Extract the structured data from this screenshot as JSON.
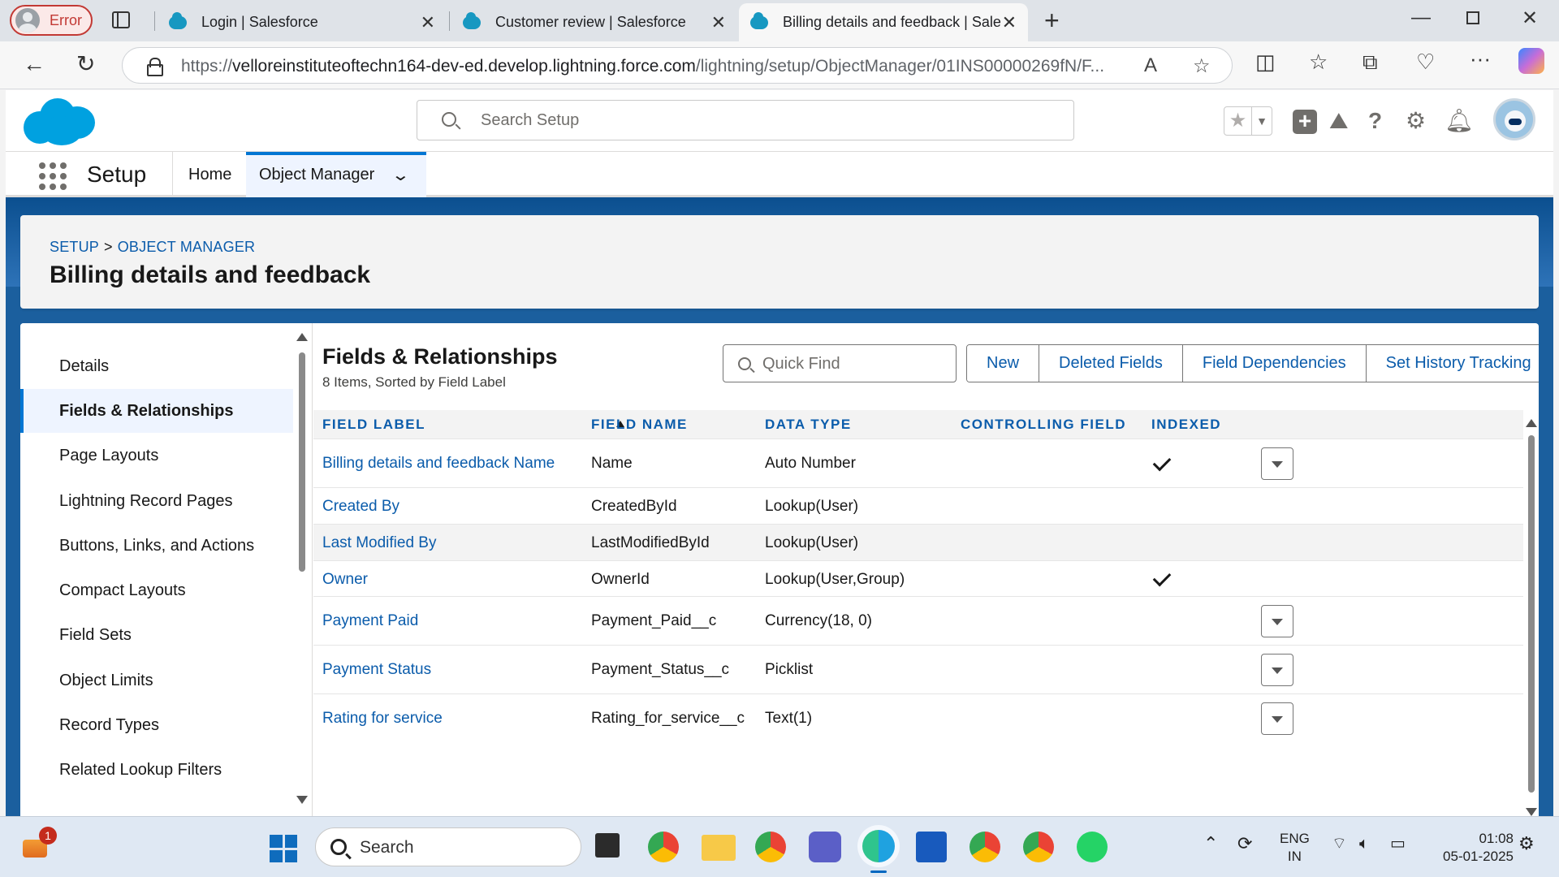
{
  "browser": {
    "profile_status": "Error",
    "tabs": [
      {
        "title": "Login | Salesforce",
        "active": false
      },
      {
        "title": "Customer review | Salesforce",
        "active": false
      },
      {
        "title": "Billing details and feedback | Sale",
        "active": true
      }
    ],
    "url_prefix": "https://",
    "url_host": "velloreinstituteoftechn164-dev-ed.develop.lightning.force.com",
    "url_path": "/lightning/setup/ObjectManager/01INS00000269fN/F..."
  },
  "sf_header": {
    "search_placeholder": "Search Setup"
  },
  "app_nav": {
    "app_name": "Setup",
    "items": [
      {
        "label": "Home"
      },
      {
        "label": "Object Manager",
        "active": true
      }
    ]
  },
  "page_header": {
    "breadcrumb_setup": "SETUP",
    "breadcrumb_sep": ">",
    "breadcrumb_object_manager": "OBJECT MANAGER",
    "title": "Billing details and feedback"
  },
  "sidebar": {
    "items": [
      {
        "label": "Details"
      },
      {
        "label": "Fields & Relationships",
        "active": true
      },
      {
        "label": "Page Layouts"
      },
      {
        "label": "Lightning Record Pages"
      },
      {
        "label": "Buttons, Links, and Actions"
      },
      {
        "label": "Compact Layouts"
      },
      {
        "label": "Field Sets"
      },
      {
        "label": "Object Limits"
      },
      {
        "label": "Record Types"
      },
      {
        "label": "Related Lookup Filters"
      }
    ]
  },
  "section": {
    "title": "Fields & Relationships",
    "subtitle": "8 Items, Sorted by Field Label",
    "quick_find_placeholder": "Quick Find",
    "buttons": [
      "New",
      "Deleted Fields",
      "Field Dependencies",
      "Set History Tracking"
    ]
  },
  "table": {
    "columns": [
      "FIELD LABEL",
      "FIELD NAME",
      "DATA TYPE",
      "CONTROLLING FIELD",
      "INDEXED"
    ],
    "rows": [
      {
        "label": "Billing details and feedback Name",
        "name": "Name",
        "type": "Auto Number",
        "indexed": true,
        "menu": true
      },
      {
        "label": "Created By",
        "name": "CreatedById",
        "type": "Lookup(User)",
        "indexed": false,
        "menu": false
      },
      {
        "label": "Last Modified By",
        "name": "LastModifiedById",
        "type": "Lookup(User)",
        "indexed": false,
        "menu": false
      },
      {
        "label": "Owner",
        "name": "OwnerId",
        "type": "Lookup(User,Group)",
        "indexed": true,
        "menu": false
      },
      {
        "label": "Payment Paid",
        "name": "Payment_Paid__c",
        "type": "Currency(18, 0)",
        "indexed": false,
        "menu": true
      },
      {
        "label": "Payment Status",
        "name": "Payment_Status__c",
        "type": "Picklist",
        "indexed": false,
        "menu": true
      },
      {
        "label": "Rating for service",
        "name": "Rating_for_service__c",
        "type": "Text(1)",
        "indexed": false,
        "menu": true
      }
    ]
  },
  "taskbar": {
    "search_label": "Search",
    "notification_count": "1",
    "language_line1": "ENG",
    "language_line2": "IN",
    "time": "01:08",
    "date": "05-01-2025"
  }
}
